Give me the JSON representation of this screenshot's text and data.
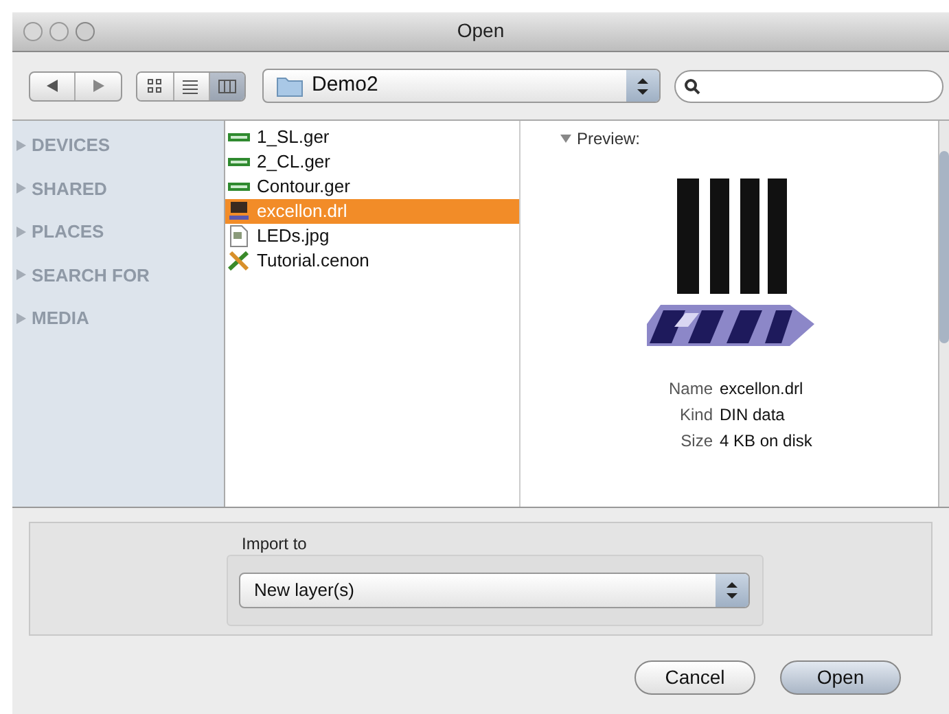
{
  "window": {
    "title": "Open"
  },
  "toolbar": {
    "view_modes": [
      {
        "kind": "icon",
        "selected": false
      },
      {
        "kind": "list",
        "selected": false
      },
      {
        "kind": "column",
        "selected": true
      }
    ],
    "location": "Demo2"
  },
  "sidebar": {
    "items": [
      {
        "label": "DEVICES",
        "expanded": false
      },
      {
        "label": "SHARED",
        "expanded": false
      },
      {
        "label": "PLACES",
        "expanded": false
      },
      {
        "label": "SEARCH FOR",
        "expanded": false
      },
      {
        "label": "MEDIA",
        "expanded": false
      }
    ]
  },
  "files": [
    {
      "name": "1_SL.ger",
      "kind": "gerber",
      "selected": false
    },
    {
      "name": "2_CL.ger",
      "kind": "gerber",
      "selected": false
    },
    {
      "name": "Contour.ger",
      "kind": "gerber",
      "selected": false
    },
    {
      "name": "excellon.drl",
      "kind": "din",
      "selected": true
    },
    {
      "name": "LEDs.jpg",
      "selected": false
    },
    {
      "name": "Tutorial.cenon",
      "kind": "cenon",
      "selected": false
    }
  ],
  "preview": {
    "header": "Preview:",
    "expanded": true,
    "info": [
      {
        "label": "Name",
        "value": "excellon.drl"
      },
      {
        "label": "Kind",
        "value": "DIN data"
      },
      {
        "label": "Size",
        "value": "4 KB on disk"
      }
    ]
  },
  "import": {
    "label": "Import to",
    "value": "New layer(s)"
  },
  "buttons": [
    {
      "label": "Cancel",
      "default": false
    },
    {
      "label": "Open",
      "default": true
    }
  ]
}
